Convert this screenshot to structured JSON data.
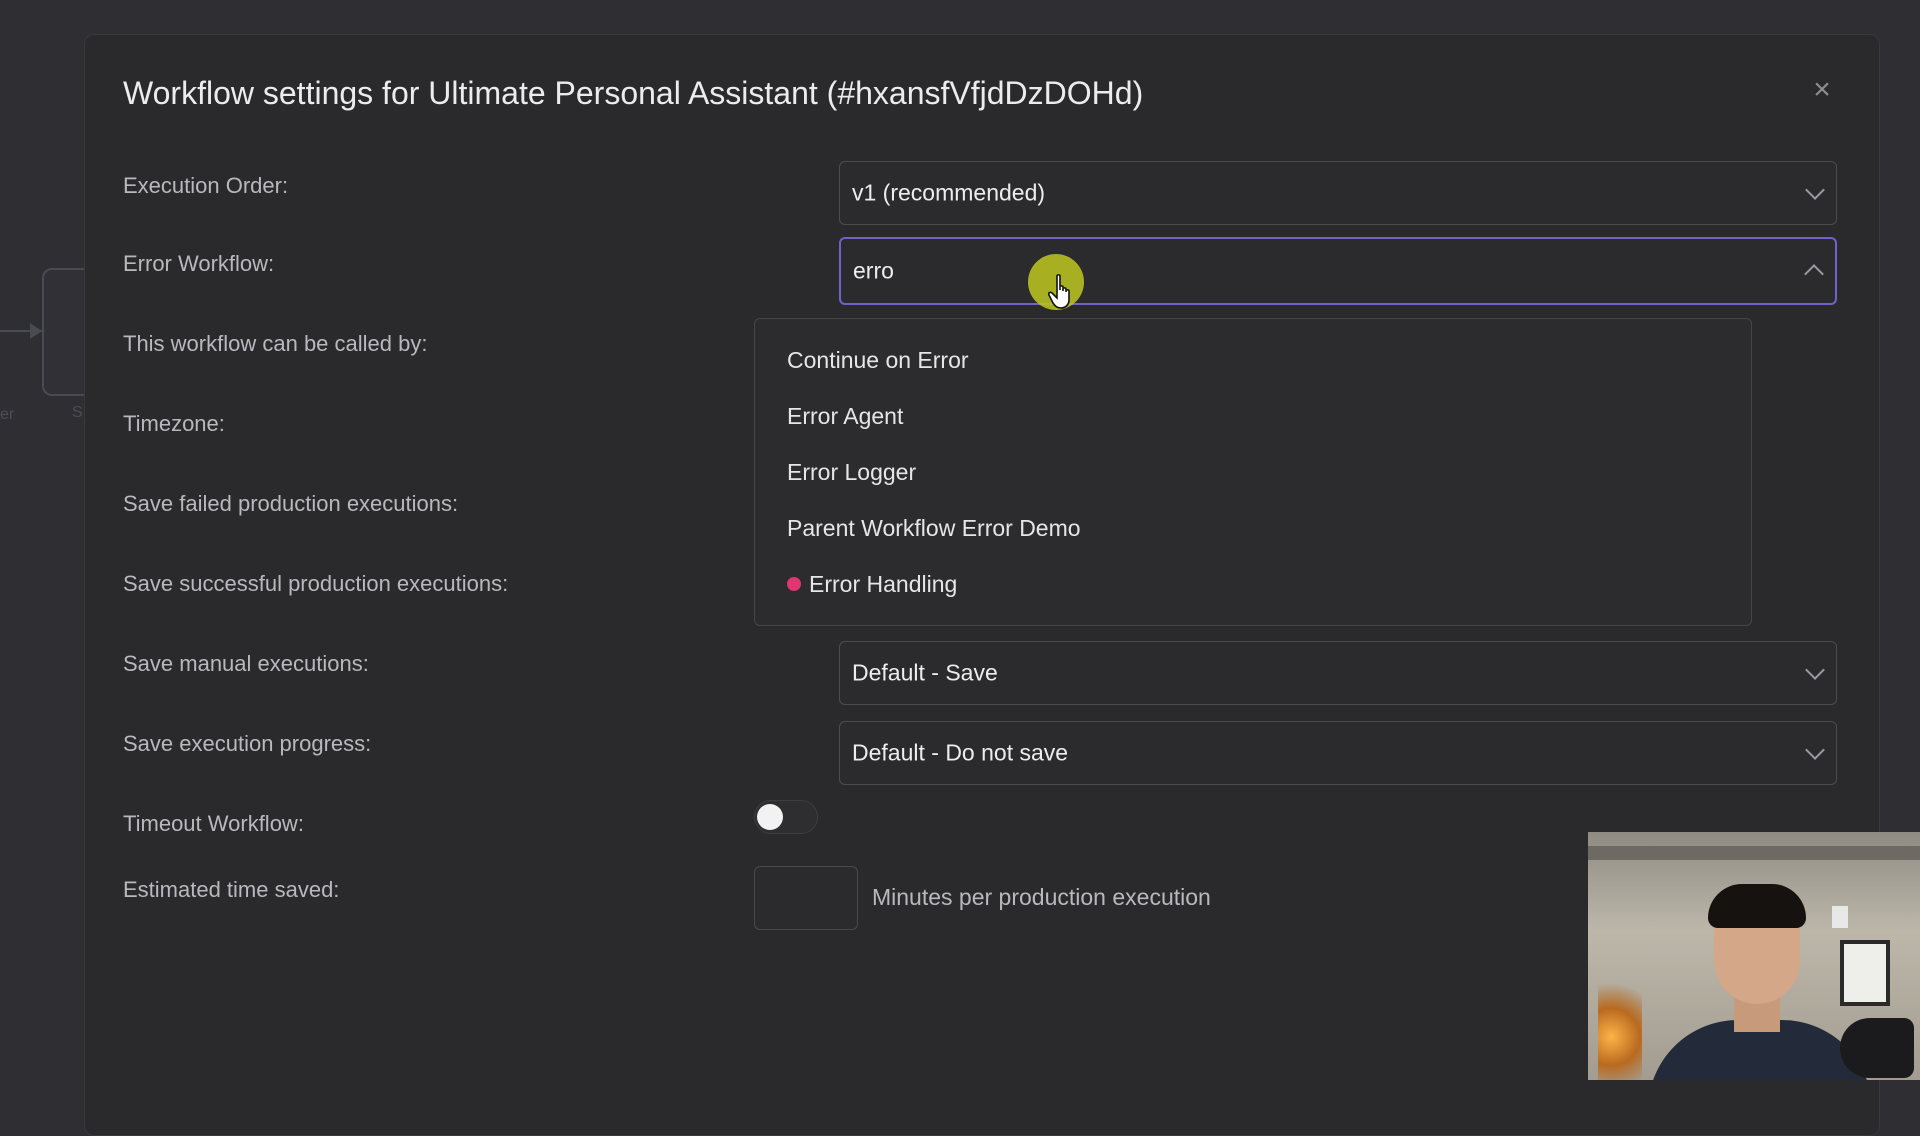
{
  "modal": {
    "title": "Workflow settings for Ultimate Personal Assistant (#hxansfVfjdDzDOHd)",
    "close_icon": "close-icon"
  },
  "settings": {
    "execution_order": {
      "label": "Execution Order:",
      "value": "v1 (recommended)"
    },
    "error_workflow": {
      "label": "Error Workflow:",
      "search_value": "erro",
      "options": [
        {
          "label": "Continue on Error"
        },
        {
          "label": "Error Agent"
        },
        {
          "label": "Error Logger"
        },
        {
          "label": "Parent Workflow Error Demo"
        },
        {
          "label": "Error Handling",
          "icon": "pink-dot-icon"
        }
      ]
    },
    "callable_by": {
      "label": "This workflow can be called by:"
    },
    "timezone": {
      "label": "Timezone:"
    },
    "save_failed": {
      "label": "Save failed production executions:"
    },
    "save_successful": {
      "label": "Save successful production executions:"
    },
    "save_manual": {
      "label": "Save manual executions:",
      "value": "Default - Save"
    },
    "save_progress": {
      "label": "Save execution progress:",
      "value": "Default - Do not save"
    },
    "timeout": {
      "label": "Timeout Workflow:",
      "enabled": false
    },
    "time_saved": {
      "label": "Estimated time saved:",
      "value": "",
      "unit": "Minutes per production execution"
    }
  },
  "background": {
    "text_left": "er",
    "text_right": "S"
  },
  "colors": {
    "accent": "#6f62c9",
    "cursor_halo": "#bec81e",
    "icon_dot": "#e0356f"
  }
}
